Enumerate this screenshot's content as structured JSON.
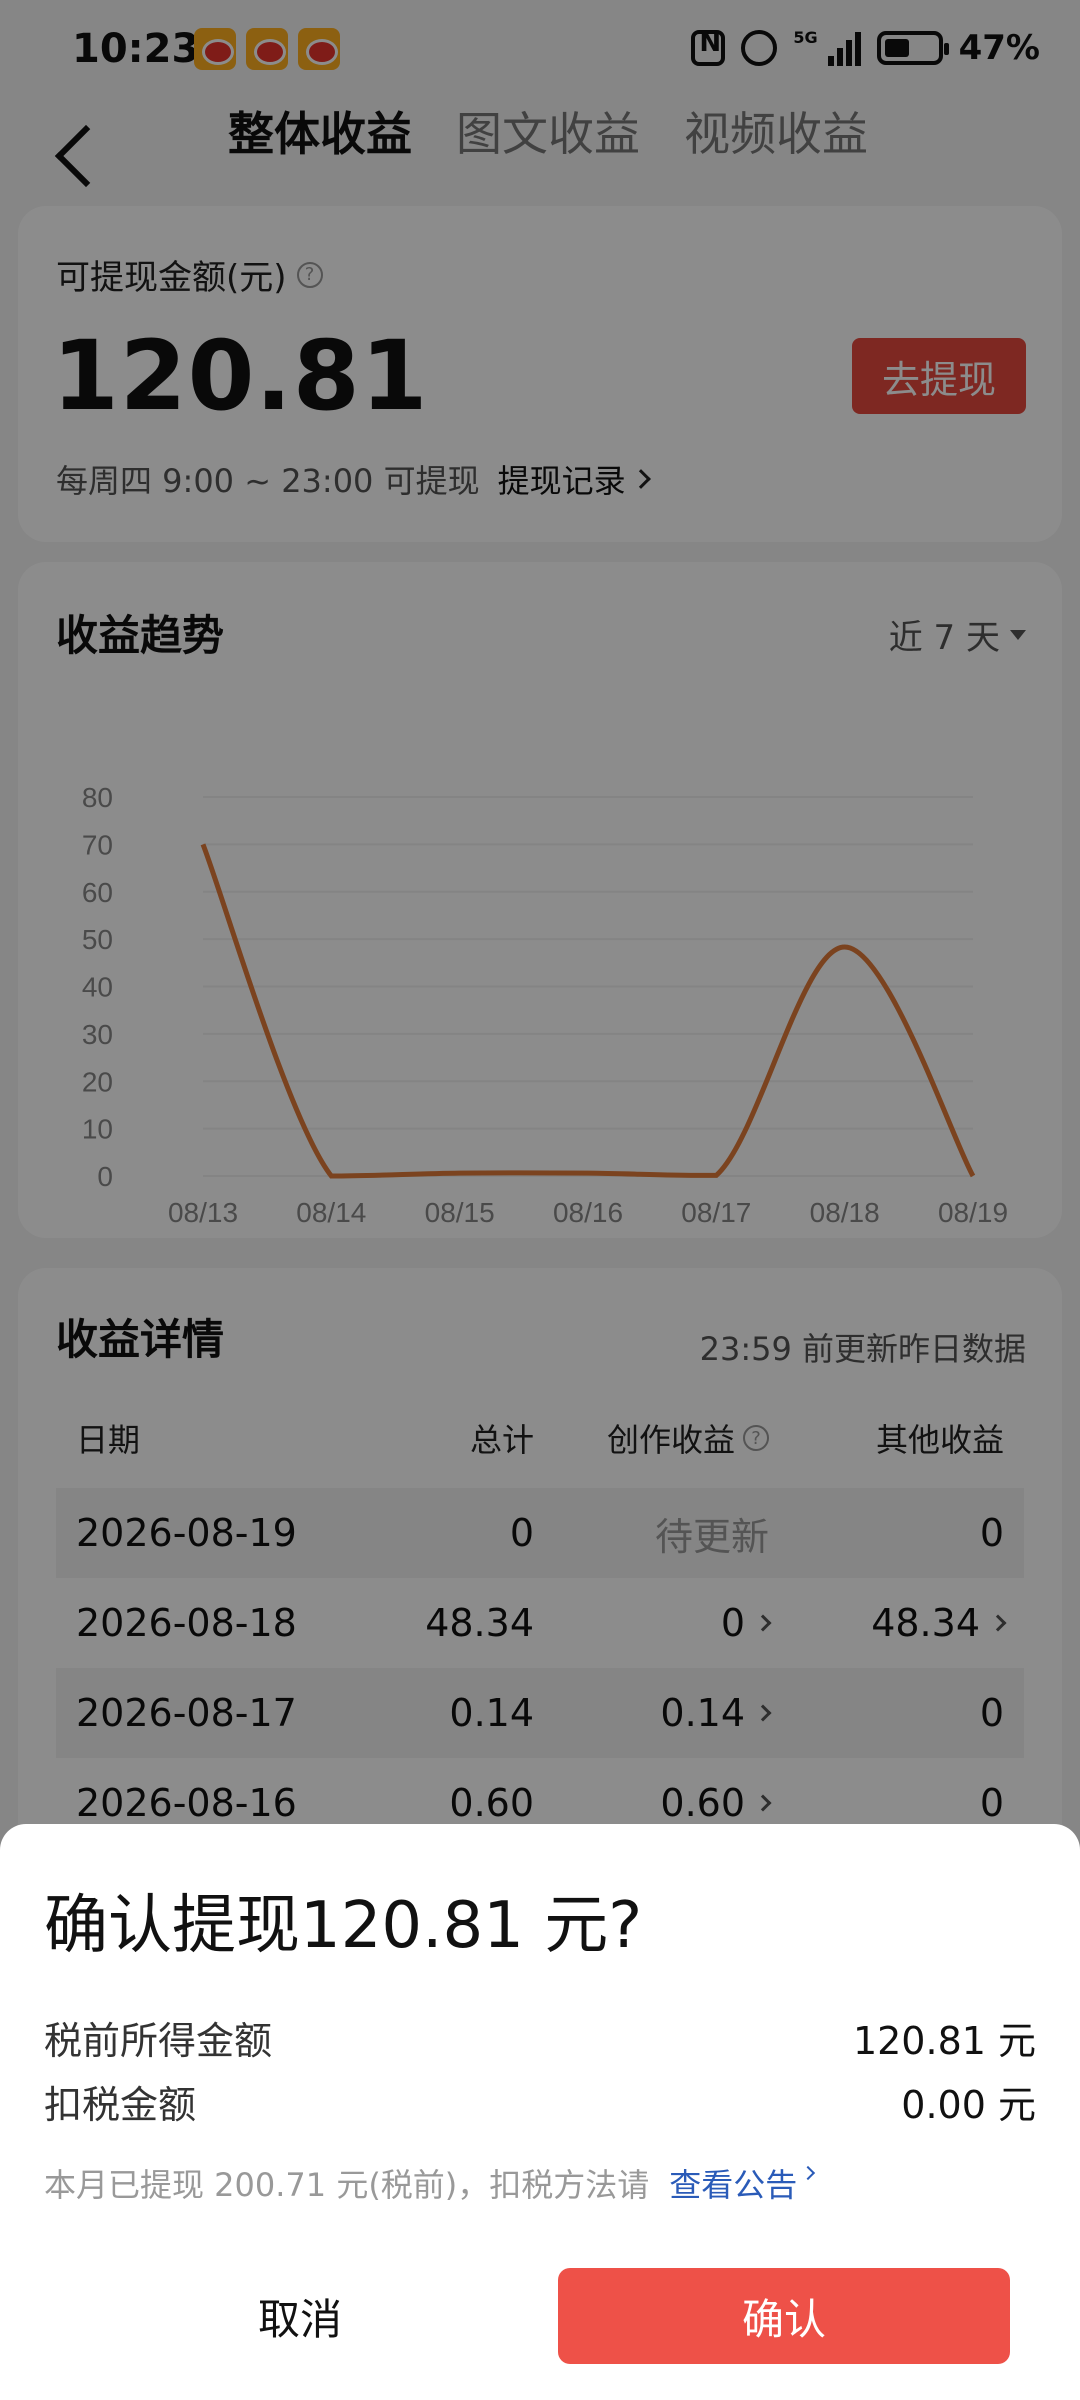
{
  "status_bar": {
    "time": "10:23",
    "notification_icons": [
      "weibo-icon",
      "weibo-icon",
      "weibo-icon"
    ],
    "battery": "47%",
    "network": "5G"
  },
  "header": {
    "tabs": [
      {
        "label": "整体收益",
        "active": true
      },
      {
        "label": "图文收益",
        "active": false
      },
      {
        "label": "视频收益",
        "active": false
      }
    ]
  },
  "balance": {
    "label": "可提现金额(元)",
    "amount": "120.81",
    "withdraw_button": "去提现",
    "schedule": "每周四 9:00 ~ 23:00 可提现",
    "records_link": "提现记录"
  },
  "trend": {
    "title": "收益趋势",
    "range": "近 7 天"
  },
  "chart_data": {
    "type": "line",
    "categories": [
      "08/13",
      "08/14",
      "08/15",
      "08/16",
      "08/17",
      "08/18",
      "08/19"
    ],
    "values": [
      70,
      0,
      0.6,
      0.6,
      0.14,
      48.34,
      0
    ],
    "yticks": [
      0,
      10,
      20,
      30,
      40,
      50,
      60,
      70,
      80
    ],
    "ylim": [
      0,
      80
    ],
    "line_color": "#e07a3a",
    "grid": true
  },
  "detail": {
    "title": "收益详情",
    "note": "23:59 前更新昨日数据",
    "headers": {
      "date": "日期",
      "total": "总计",
      "creation": "创作收益",
      "other": "其他收益"
    },
    "rows": [
      {
        "date": "2026-08-19",
        "total": "0",
        "creation": "待更新",
        "other": "0"
      },
      {
        "date": "2026-08-18",
        "total": "48.34",
        "creation": "0",
        "other": "48.34"
      },
      {
        "date": "2026-08-17",
        "total": "0.14",
        "creation": "0.14",
        "other": "0"
      },
      {
        "date": "2026-08-16",
        "total": "0.60",
        "creation": "0.60",
        "other": "0"
      }
    ]
  },
  "sheet": {
    "title": "确认提现120.81 元?",
    "pretax_label": "税前所得金额",
    "pretax_value": "120.81 元",
    "tax_label": "扣税金额",
    "tax_value": "0.00 元",
    "note": "本月已提现 200.71 元(税前)，扣税方法请",
    "notice_link": "查看公告",
    "cancel": "取消",
    "confirm": "确认"
  },
  "colors": {
    "accent": "#e64a3e",
    "confirm": "#ee5148",
    "link": "#2a5bb8"
  }
}
